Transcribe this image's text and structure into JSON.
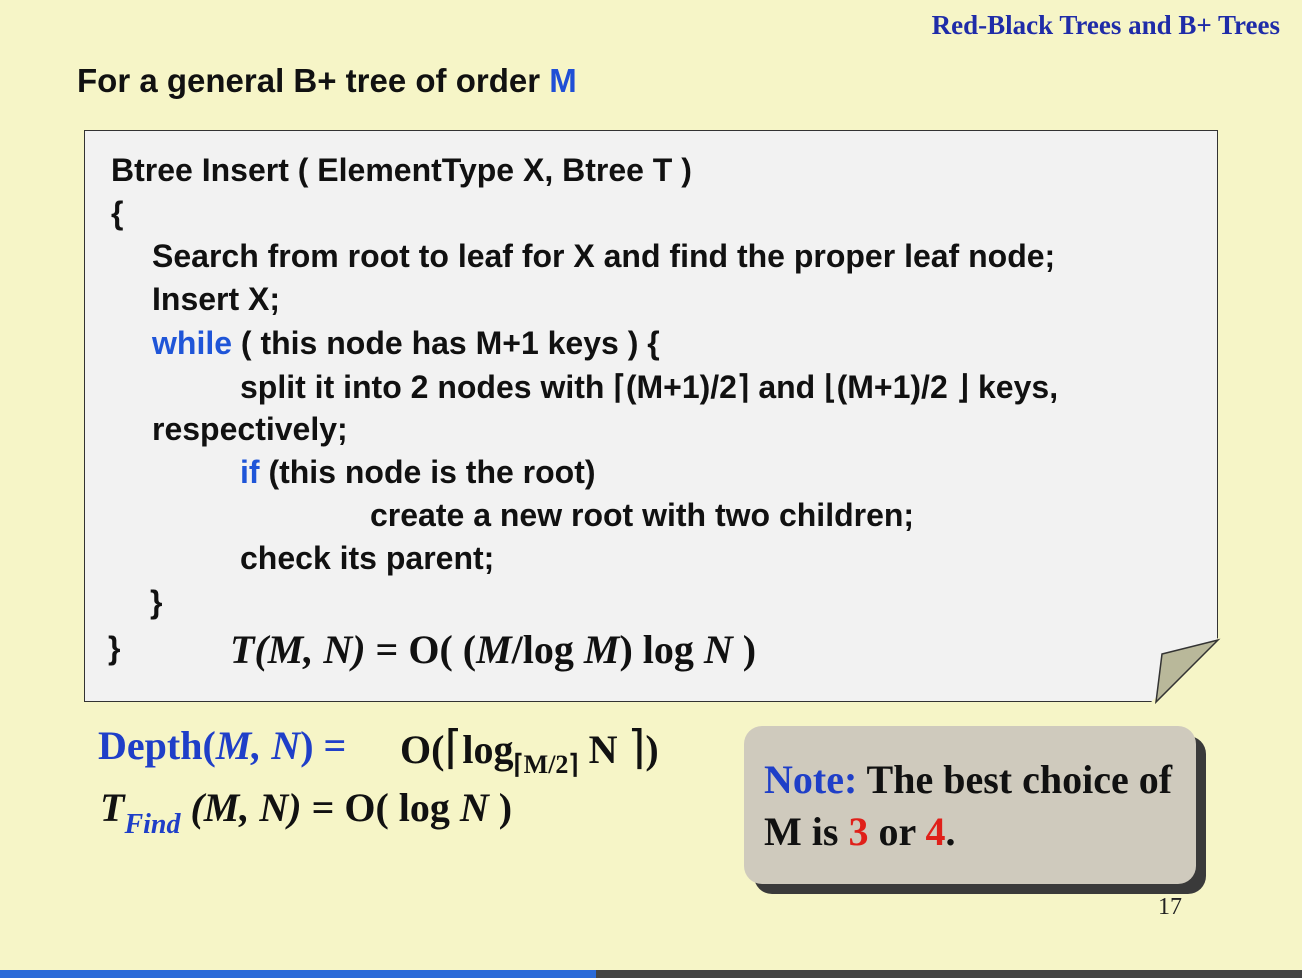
{
  "slide": {
    "header_title": "Red-Black Trees and B+ Trees",
    "subtitle_prefix": "For a general B+ tree of order ",
    "subtitle_var": "M",
    "page_number": "17"
  },
  "code": {
    "line1": "Btree  Insert ( ElementType X,  Btree T )",
    "line2": "{",
    "line3": "Search from root to leaf for X and find the proper leaf node;",
    "line4": "Insert X;",
    "line5_kw": "while",
    "line5_rest": " ( this node has M+1 keys ) {",
    "line6a": "split it into 2 nodes with ",
    "line6b": "⌈(M+1)/2⌉",
    "line6c": " and ",
    "line6d": "⌊(M+1)/2 ⌋",
    "line6e": " keys,",
    "line7": "respectively;",
    "line8_kw": "if",
    "line8_rest": " (this node is the root)",
    "line9": "create a new root with two children;",
    "line10": "check its parent;",
    "line11": "}",
    "line12": "}"
  },
  "formulas": {
    "t_insert": {
      "T": "T",
      "args": "(M, N)",
      "eq": " = O( (",
      "m": "M",
      "log": "/log ",
      "m2": "M",
      "rest": ") log ",
      "n": "N",
      "close": " )"
    },
    "depth": {
      "label": "Depth(",
      "args": "M, N",
      "close_eq": ") =",
      "big_o": "O(",
      "ceil_open": "⌈",
      "log": "log",
      "sub": "⌈M/2⌉",
      "n": " N ",
      "ceil_close": "⌉",
      "end": ")"
    },
    "t_find": {
      "T": "T",
      "sub": "Find",
      "args": " (M, N)",
      "eq": " = O( log ",
      "n": "N",
      "close": " )"
    }
  },
  "note": {
    "label": "Note:",
    "text1": " The best choice of M is ",
    "v1": "3",
    "or": " or ",
    "v2": "4",
    "end": "."
  },
  "progress": {
    "fraction": 0.458,
    "fill_color": "#2a6ad8"
  }
}
